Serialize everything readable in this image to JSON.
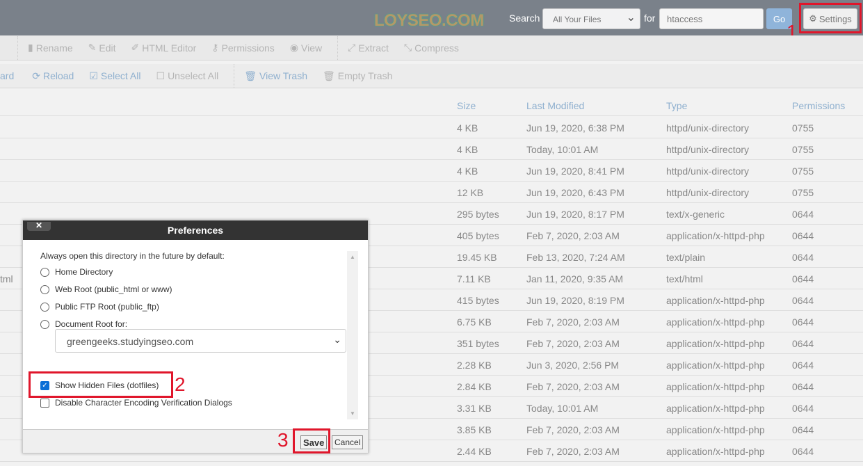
{
  "header": {
    "logo": "LOYSEO.COM",
    "search_label": "Search",
    "search_scope": "All Your Files",
    "for_label": "for",
    "search_value": "htaccess",
    "go": "Go",
    "settings": "Settings"
  },
  "toolbar1": [
    {
      "icon": "file-icon",
      "label": "Rename"
    },
    {
      "icon": "pencil-icon",
      "label": "Edit"
    },
    {
      "icon": "edit-square-icon",
      "label": "HTML Editor"
    },
    {
      "icon": "key-icon",
      "label": "Permissions"
    },
    {
      "icon": "eye-icon",
      "label": "View"
    },
    {
      "icon": "expand-icon",
      "label": "Extract"
    },
    {
      "icon": "compress-icon",
      "label": "Compress"
    }
  ],
  "toolbar2": {
    "partial": "ard",
    "items": [
      {
        "icon": "reload-icon",
        "label": "Reload"
      },
      {
        "icon": "checkbox-checked-icon",
        "label": "Select All"
      },
      {
        "icon": "checkbox-empty-icon",
        "label": "Unselect All"
      },
      {
        "icon": "trash-icon",
        "label": "View Trash"
      },
      {
        "icon": "trash-icon",
        "label": "Empty Trash"
      }
    ]
  },
  "table": {
    "headers": [
      "Size",
      "Last Modified",
      "Type",
      "Permissions"
    ],
    "rows": [
      {
        "name": "",
        "size": "4 KB",
        "modified": "Jun 19, 2020, 6:38 PM",
        "type": "httpd/unix-directory",
        "perm": "0755"
      },
      {
        "name": "",
        "size": "4 KB",
        "modified": "Today, 10:01 AM",
        "type": "httpd/unix-directory",
        "perm": "0755"
      },
      {
        "name": "",
        "size": "4 KB",
        "modified": "Jun 19, 2020, 8:41 PM",
        "type": "httpd/unix-directory",
        "perm": "0755"
      },
      {
        "name": "",
        "size": "12 KB",
        "modified": "Jun 19, 2020, 6:43 PM",
        "type": "httpd/unix-directory",
        "perm": "0755"
      },
      {
        "name": "",
        "size": "295 bytes",
        "modified": "Jun 19, 2020, 8:17 PM",
        "type": "text/x-generic",
        "perm": "0644"
      },
      {
        "name": "",
        "size": "405 bytes",
        "modified": "Feb 7, 2020, 2:03 AM",
        "type": "application/x-httpd-php",
        "perm": "0644"
      },
      {
        "name": "",
        "size": "19.45 KB",
        "modified": "Feb 13, 2020, 7:24 AM",
        "type": "text/plain",
        "perm": "0644"
      },
      {
        "name": "tml",
        "size": "7.11 KB",
        "modified": "Jan 11, 2020, 9:35 AM",
        "type": "text/html",
        "perm": "0644"
      },
      {
        "name": "",
        "size": "415 bytes",
        "modified": "Jun 19, 2020, 8:19 PM",
        "type": "application/x-httpd-php",
        "perm": "0644"
      },
      {
        "name": "",
        "size": "6.75 KB",
        "modified": "Feb 7, 2020, 2:03 AM",
        "type": "application/x-httpd-php",
        "perm": "0644"
      },
      {
        "name": "",
        "size": "351 bytes",
        "modified": "Feb 7, 2020, 2:03 AM",
        "type": "application/x-httpd-php",
        "perm": "0644"
      },
      {
        "name": "",
        "size": "2.28 KB",
        "modified": "Jun 3, 2020, 2:56 PM",
        "type": "application/x-httpd-php",
        "perm": "0644"
      },
      {
        "name": "",
        "size": "2.84 KB",
        "modified": "Feb 7, 2020, 2:03 AM",
        "type": "application/x-httpd-php",
        "perm": "0644"
      },
      {
        "name": "",
        "size": "3.31 KB",
        "modified": "Today, 10:01 AM",
        "type": "application/x-httpd-php",
        "perm": "0644"
      },
      {
        "name": "",
        "size": "3.85 KB",
        "modified": "Feb 7, 2020, 2:03 AM",
        "type": "application/x-httpd-php",
        "perm": "0644"
      },
      {
        "name": "",
        "size": "2.44 KB",
        "modified": "Feb 7, 2020, 2:03 AM",
        "type": "application/x-httpd-php",
        "perm": "0644"
      }
    ]
  },
  "dialog": {
    "title": "Preferences",
    "close": "✕",
    "intro": "Always open this directory in the future by default:",
    "radios": [
      "Home Directory",
      "Web Root (public_html or www)",
      "Public FTP Root (public_ftp)",
      "Document Root for:"
    ],
    "docroot_value": "greengeeks.studyingseo.com",
    "show_hidden": "Show Hidden Files (dotfiles)",
    "show_hidden_checked": true,
    "disable_encoding": "Disable Character Encoding Verification Dialogs",
    "disable_encoding_checked": false,
    "save": "Save",
    "cancel": "Cancel"
  },
  "annotations": [
    "1",
    "2",
    "3"
  ],
  "colors": {
    "header_bg": "#7a818a",
    "link": "#8fb0cf",
    "highlight": "#e0162b",
    "dialog_title": "#333333"
  }
}
